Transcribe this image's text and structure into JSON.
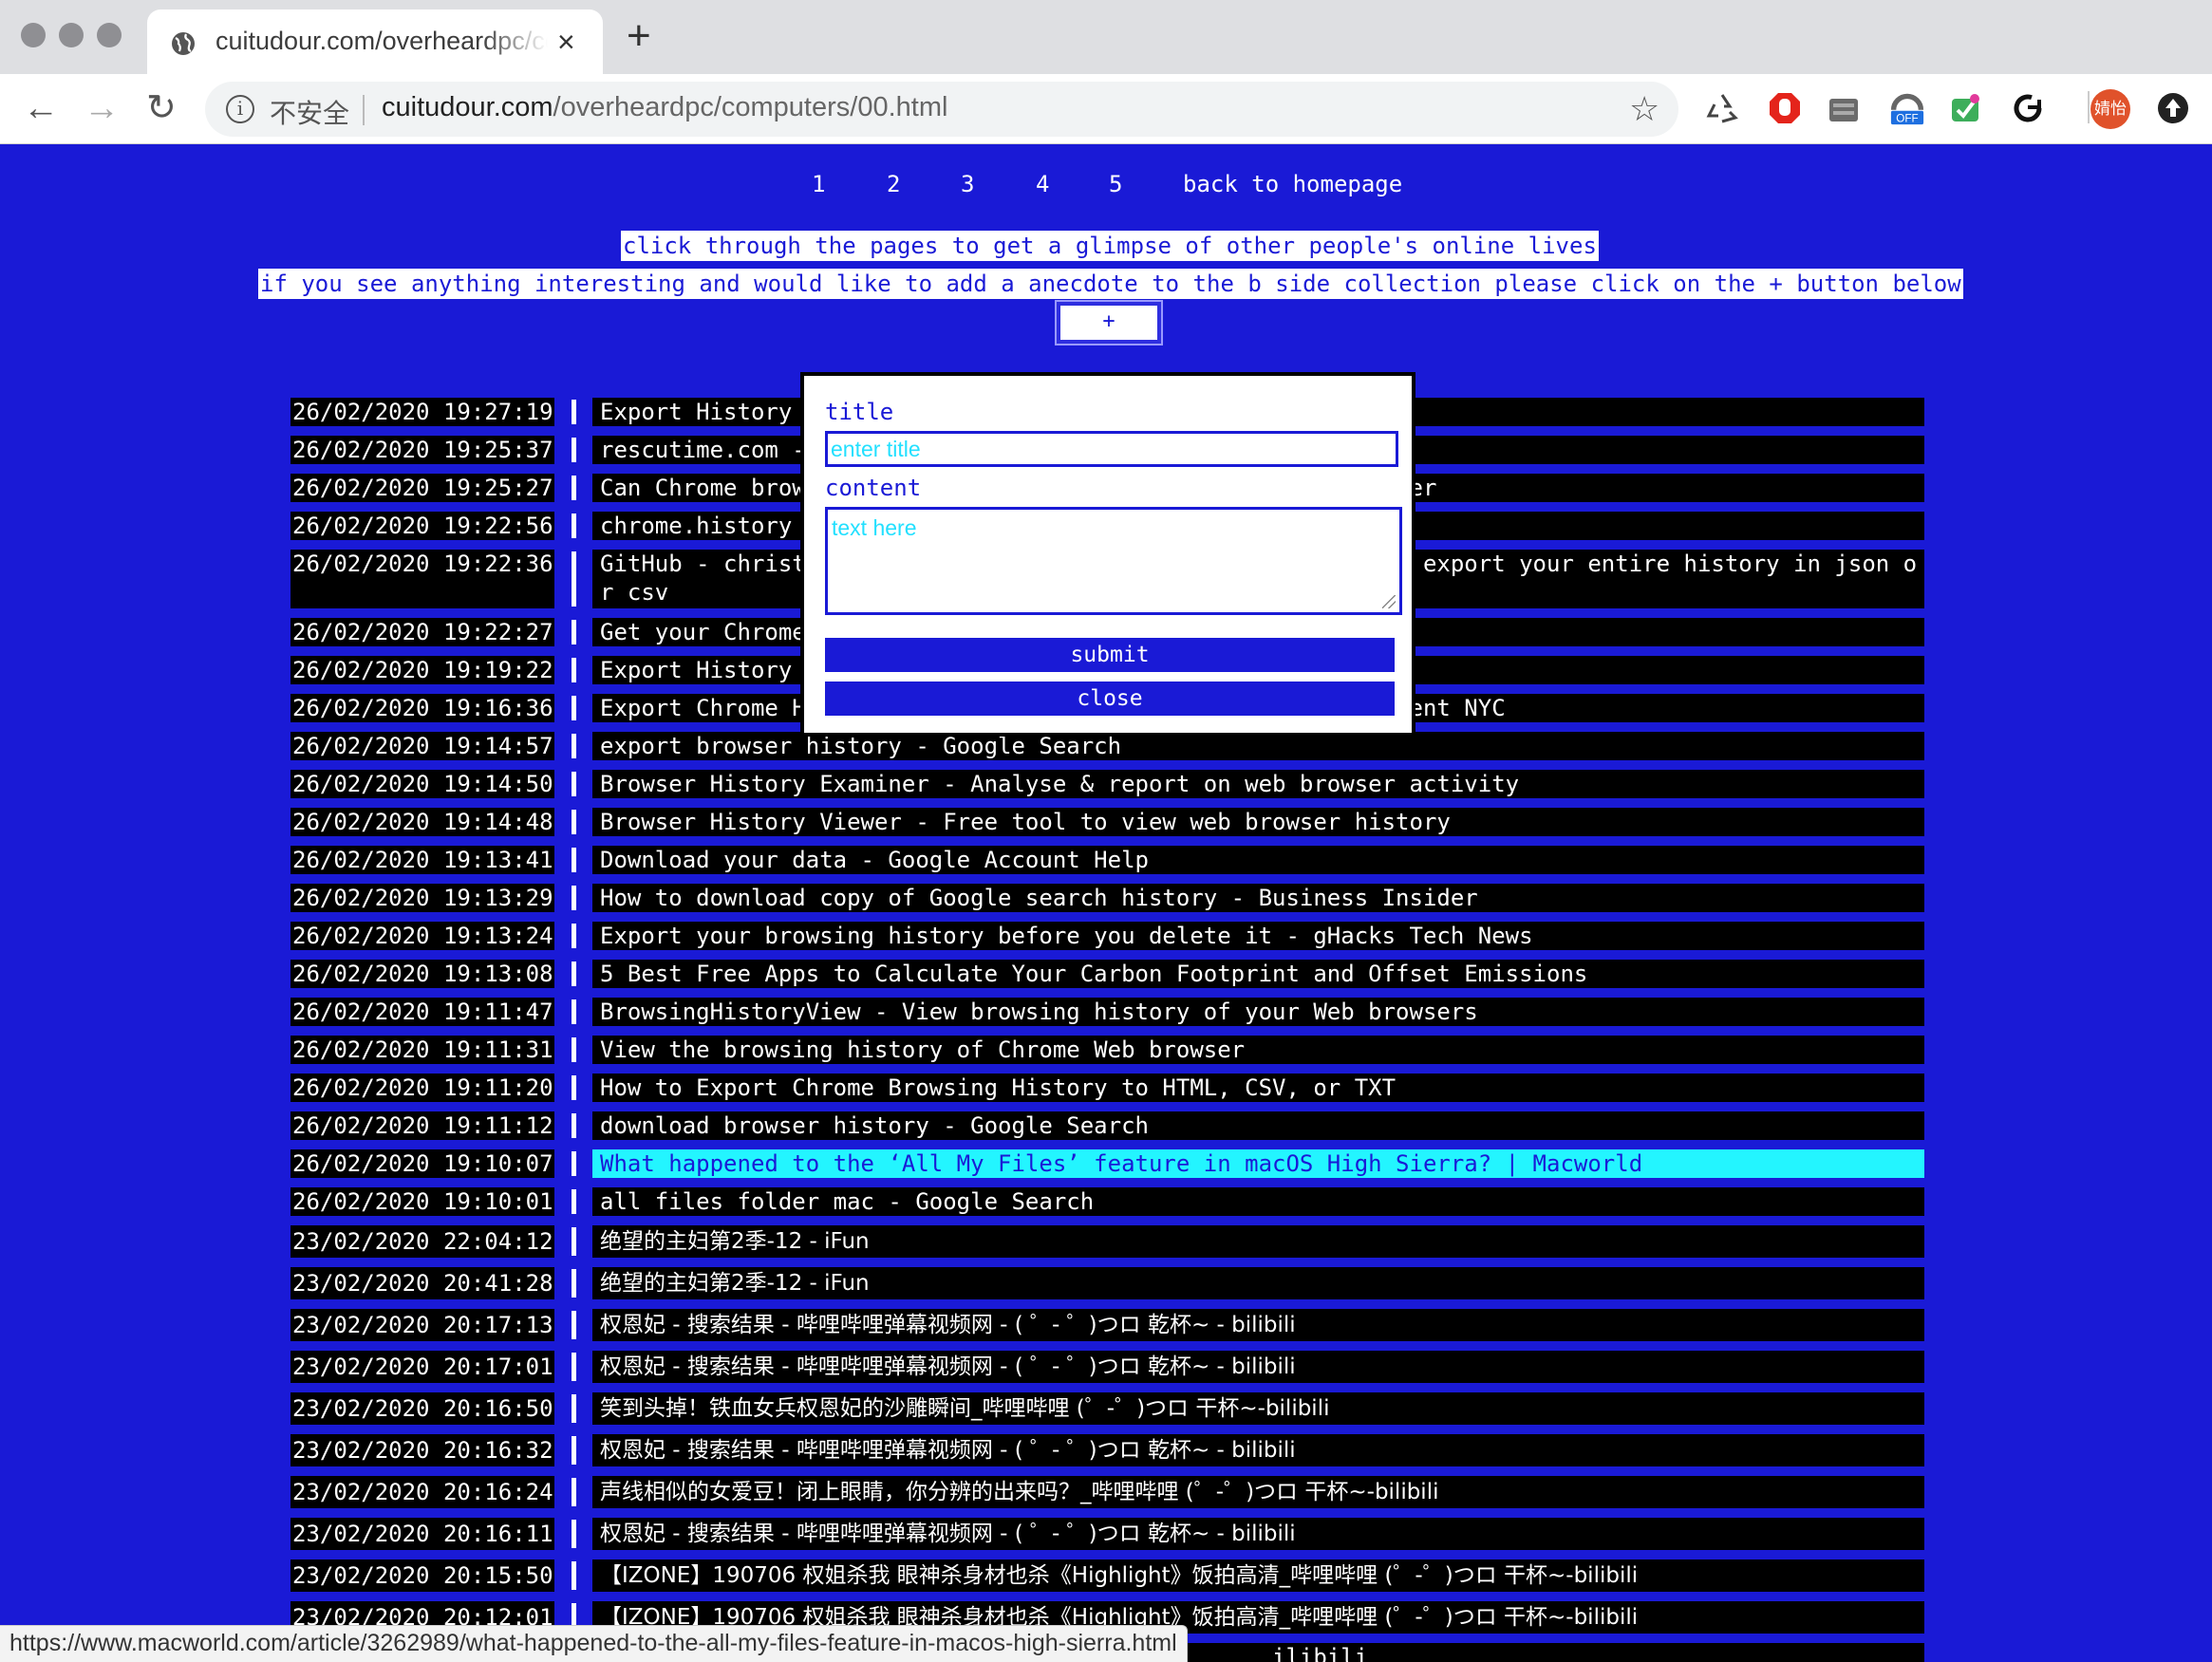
{
  "browser": {
    "tab_title": "cuitudour.com/overheardpc/co",
    "new_tab": "+",
    "tab_close": "×",
    "insecure_label": "不安全",
    "url_host": "cuitudour.com",
    "url_path": "/overheardpc/computers/00.html",
    "back_glyph": "←",
    "forward_glyph": "→",
    "reload_glyph": "↻",
    "star_glyph": "☆",
    "info_glyph": "i",
    "profile_label": "婧怡",
    "extension_badge": "OFF",
    "status_url": "https://www.macworld.com/article/3262989/what-happened-to-the-all-my-files-feature-in-macos-high-sierra.html"
  },
  "pager": {
    "pages": [
      "1",
      "2",
      "3",
      "4",
      "5"
    ],
    "home_label": "back to homepage"
  },
  "intro": {
    "line1": "click through the pages to get a glimpse of other people's online lives",
    "line2": "if you see anything interesting and would like to add a anecdote to the b side collection please click on the + button below",
    "add_button": "+"
  },
  "history": [
    {
      "time": "26/02/2020 19:27:19",
      "title": "Export History"
    },
    {
      "time": "26/02/2020 19:25:37",
      "title": "rescutime.com -"
    },
    {
      "time": "26/02/2020 19:25:27",
      "title": "Can Chrome brow                                      per User"
    },
    {
      "time": "26/02/2020 19:22:56",
      "title": "chrome.history"
    },
    {
      "time": "26/02/2020 19:22:36",
      "title": "GitHub - christ                                      ion to export your entire history in json or csv"
    },
    {
      "time": "26/02/2020 19:22:27",
      "title": "Get your Chrome"
    },
    {
      "time": "26/02/2020 19:19:22",
      "title": "Export History"
    },
    {
      "time": "26/02/2020 19:16:36",
      "title": "Export Chrome H                                      epartment NYC"
    },
    {
      "time": "26/02/2020 19:14:57",
      "title": "export browser history - Google Search"
    },
    {
      "time": "26/02/2020 19:14:50",
      "title": "Browser History Examiner - Analyse & report on web browser activity"
    },
    {
      "time": "26/02/2020 19:14:48",
      "title": "Browser History Viewer - Free tool to view web browser history"
    },
    {
      "time": "26/02/2020 19:13:41",
      "title": "Download your data - Google Account Help"
    },
    {
      "time": "26/02/2020 19:13:29",
      "title": "How to download copy of Google search history - Business Insider"
    },
    {
      "time": "26/02/2020 19:13:24",
      "title": "Export your browsing history before you delete it - gHacks Tech News"
    },
    {
      "time": "26/02/2020 19:13:08",
      "title": "5 Best Free Apps to Calculate Your Carbon Footprint and Offset Emissions"
    },
    {
      "time": "26/02/2020 19:11:47",
      "title": "BrowsingHistoryView - View browsing history of your Web browsers"
    },
    {
      "time": "26/02/2020 19:11:31",
      "title": "View the browsing history of Chrome Web browser"
    },
    {
      "time": "26/02/2020 19:11:20",
      "title": "How to Export Chrome Browsing History to HTML, CSV, or TXT"
    },
    {
      "time": "26/02/2020 19:11:12",
      "title": "download browser history - Google Search"
    },
    {
      "time": "26/02/2020 19:10:07",
      "title": "What happened to the ‘All My Files’ feature in macOS High Sierra? | Macworld"
    },
    {
      "time": "26/02/2020 19:10:01",
      "title": "all files folder mac - Google Search"
    },
    {
      "time": "23/02/2020 22:04:12",
      "title": "绝望的主妇第2季-12 - iFun"
    },
    {
      "time": "23/02/2020 20:41:28",
      "title": "绝望的主妇第2季-12 - iFun"
    },
    {
      "time": "23/02/2020 20:17:13",
      "title": "权恩妃 - 搜索结果 - 哔哩哔哩弹幕视频网 - ( ゜- ゜)つロ 乾杯~ - bilibili"
    },
    {
      "time": "23/02/2020 20:17:01",
      "title": "权恩妃 - 搜索结果 - 哔哩哔哩弹幕视频网 - ( ゜- ゜)つロ 乾杯~ - bilibili"
    },
    {
      "time": "23/02/2020 20:16:50",
      "title": "笑到头掉！铁血女兵权恩妃的沙雕瞬间_哔哩哔哩 (゜-゜)つロ 干杯~-bilibili"
    },
    {
      "time": "23/02/2020 20:16:32",
      "title": "权恩妃 - 搜索结果 - 哔哩哔哩弹幕视频网 - ( ゜- ゜)つロ 乾杯~ - bilibili"
    },
    {
      "time": "23/02/2020 20:16:24",
      "title": "声线相似的女爱豆！闭上眼睛，你分辨的出来吗？_哔哩哔哩 (゜-゜)つロ 干杯~-bilibili"
    },
    {
      "time": "23/02/2020 20:16:11",
      "title": "权恩妃 - 搜索结果 - 哔哩哔哩弹幕视频网 - ( ゜- ゜)つロ 乾杯~ - bilibili"
    },
    {
      "time": "23/02/2020 20:15:50",
      "title": "【IZONE】190706 权姐杀我 眼神杀身材也杀《Highlight》饭拍高清_哔哩哔哩 (゜-゜)つロ 干杯~-bilibili"
    },
    {
      "time": "23/02/2020 20:12:01",
      "title": "【IZONE】190706 权姐杀我 眼神杀身材也杀《Highlight》饭拍高清_哔哩哔哩 (゜-゜)つロ 干杯~-bilibili"
    },
    {
      "time": "",
      "title": "                                                 ilibili"
    }
  ],
  "modal": {
    "title_label": "title",
    "title_placeholder": "enter title",
    "content_label": "content",
    "content_placeholder": "text here",
    "submit_label": "submit",
    "close_label": "close"
  },
  "colors": {
    "page_bg": "#1a1ad6",
    "highlight_row": "#23f5ff",
    "placeholder": "#23e0ff"
  }
}
